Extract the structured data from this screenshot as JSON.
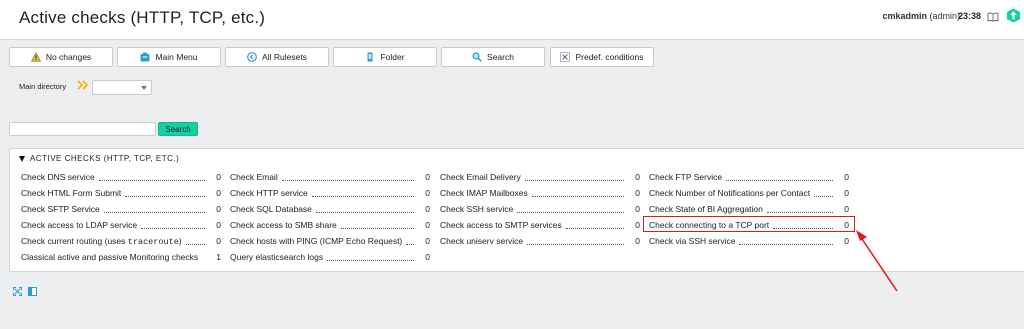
{
  "header": {
    "title": "Active checks (HTTP, TCP, etc.)",
    "username": "cmkadmin",
    "role": "(admin)",
    "time": "23:38"
  },
  "toolbar": {
    "buttons": [
      {
        "label": "No changes",
        "icon": "warning-icon"
      },
      {
        "label": "Main Menu",
        "icon": "home-icon"
      },
      {
        "label": "All Rulesets",
        "icon": "all-rulesets-icon"
      },
      {
        "label": "Folder",
        "icon": "folder-icon"
      },
      {
        "label": "Search",
        "icon": "search-icon"
      },
      {
        "label": "Predef. conditions",
        "icon": "conditions-icon"
      }
    ]
  },
  "directory": {
    "label": "Main directory",
    "selected": ""
  },
  "search": {
    "value": "",
    "button_label": "Search"
  },
  "panel": {
    "title": "ACTIVE CHECKS (HTTP, TCP, ETC.)",
    "columns": [
      [
        {
          "name": "Check DNS service",
          "count": "0"
        },
        {
          "name": "Check HTML Form Submit",
          "count": "0"
        },
        {
          "name": "Check SFTP Service",
          "count": "0"
        },
        {
          "name": "Check access to LDAP service",
          "count": "0"
        },
        {
          "name_prefix": "Check current routing (uses ",
          "name_code": "traceroute",
          "name_suffix": ")",
          "count": "0"
        },
        {
          "name": "Classical active and passive Monitoring checks",
          "count": "1"
        }
      ],
      [
        {
          "name": "Check Email",
          "count": "0"
        },
        {
          "name": "Check HTTP service",
          "count": "0"
        },
        {
          "name": "Check SQL Database",
          "count": "0"
        },
        {
          "name": "Check access to SMB share",
          "count": "0"
        },
        {
          "name": "Check hosts with PING (ICMP Echo Request)",
          "count": "0"
        },
        {
          "name": "Query elasticsearch logs",
          "count": "0"
        }
      ],
      [
        {
          "name": "Check Email Delivery",
          "count": "0"
        },
        {
          "name": "Check IMAP Mailboxes",
          "count": "0"
        },
        {
          "name": "Check SSH service",
          "count": "0"
        },
        {
          "name": "Check access to SMTP services",
          "count": "0"
        },
        {
          "name": "Check uniserv service",
          "count": "0"
        }
      ],
      [
        {
          "name": "Check FTP Service",
          "count": "0"
        },
        {
          "name": "Check Number of Notifications per Contact",
          "count": "0"
        },
        {
          "name": "Check State of BI Aggregation",
          "count": "0"
        },
        {
          "name": "Check connecting to a TCP port",
          "count": "0",
          "highlighted": true
        },
        {
          "name": "Check via SSH service",
          "count": "0"
        }
      ]
    ]
  },
  "annotation": {
    "color": "#e01818"
  },
  "colors": {
    "accent": "#15d1a0",
    "background": "#eceef0"
  }
}
